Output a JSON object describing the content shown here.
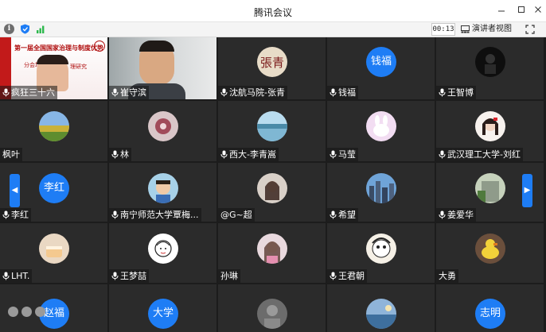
{
  "window": {
    "title": "腾讯会议"
  },
  "toolbar": {
    "timer": "00:13",
    "view_label": "演讲者视图"
  },
  "participants": [
    {
      "name": "疯狂三十六",
      "avatar_text": "",
      "kind": "video-slide",
      "mic": true
    },
    {
      "name": "崔守滨",
      "avatar_text": "",
      "kind": "video-face",
      "mic": true
    },
    {
      "name": "沈航马院-张青",
      "avatar_text": "",
      "kind": "avatar-calligraphy",
      "mic": true
    },
    {
      "name": "钱福",
      "avatar_text": "钱福",
      "kind": "avatar-text",
      "mic": true
    },
    {
      "name": "王智博",
      "avatar_text": "",
      "kind": "avatar-dark",
      "mic": true
    },
    {
      "name": "枫叶",
      "avatar_text": "",
      "kind": "avatar-landscape",
      "mic": false
    },
    {
      "name": "林",
      "avatar_text": "",
      "kind": "avatar-flower",
      "mic": true
    },
    {
      "name": "西大-李青嵩",
      "avatar_text": "",
      "kind": "avatar-lake",
      "mic": true
    },
    {
      "name": "马莹",
      "avatar_text": "",
      "kind": "avatar-bunny",
      "mic": true
    },
    {
      "name": "武汉理工大学-刘红",
      "avatar_text": "",
      "kind": "avatar-girl",
      "mic": true
    },
    {
      "name": "李红",
      "avatar_text": "李红",
      "kind": "avatar-text",
      "mic": true
    },
    {
      "name": "南宁师范大学覃梅...",
      "avatar_text": "",
      "kind": "avatar-child",
      "mic": true
    },
    {
      "name": "@G~超",
      "avatar_text": "",
      "kind": "avatar-portrait",
      "mic": false
    },
    {
      "name": "希望",
      "avatar_text": "",
      "kind": "avatar-city",
      "mic": true
    },
    {
      "name": "姜爱华",
      "avatar_text": "",
      "kind": "avatar-building",
      "mic": true
    },
    {
      "name": "LHT.",
      "avatar_text": "",
      "kind": "avatar-cake",
      "mic": true
    },
    {
      "name": "王梦喆",
      "avatar_text": "",
      "kind": "avatar-sketch",
      "mic": true
    },
    {
      "name": "孙琳",
      "avatar_text": "",
      "kind": "avatar-pink",
      "mic": false
    },
    {
      "name": "王君朝",
      "avatar_text": "",
      "kind": "avatar-cartoon",
      "mic": true
    },
    {
      "name": "大勇",
      "avatar_text": "",
      "kind": "avatar-duck",
      "mic": false
    },
    {
      "name": "",
      "avatar_text": "赵福",
      "kind": "avatar-text",
      "mic": false
    },
    {
      "name": "",
      "avatar_text": "大学",
      "kind": "avatar-text",
      "mic": false
    },
    {
      "name": "",
      "avatar_text": "",
      "kind": "avatar-gray",
      "mic": false
    },
    {
      "name": "",
      "avatar_text": "",
      "kind": "avatar-sea",
      "mic": false
    },
    {
      "name": "",
      "avatar_text": "志明",
      "kind": "avatar-text",
      "mic": false
    }
  ],
  "slide": {
    "title": "第一届全国国家治理与制度优势",
    "subtitle": "分会场",
    "tag": "理研究"
  },
  "colors": {
    "accent": "#1e7df5",
    "tile": "#2b2b2b",
    "background": "#1c1c1c"
  }
}
